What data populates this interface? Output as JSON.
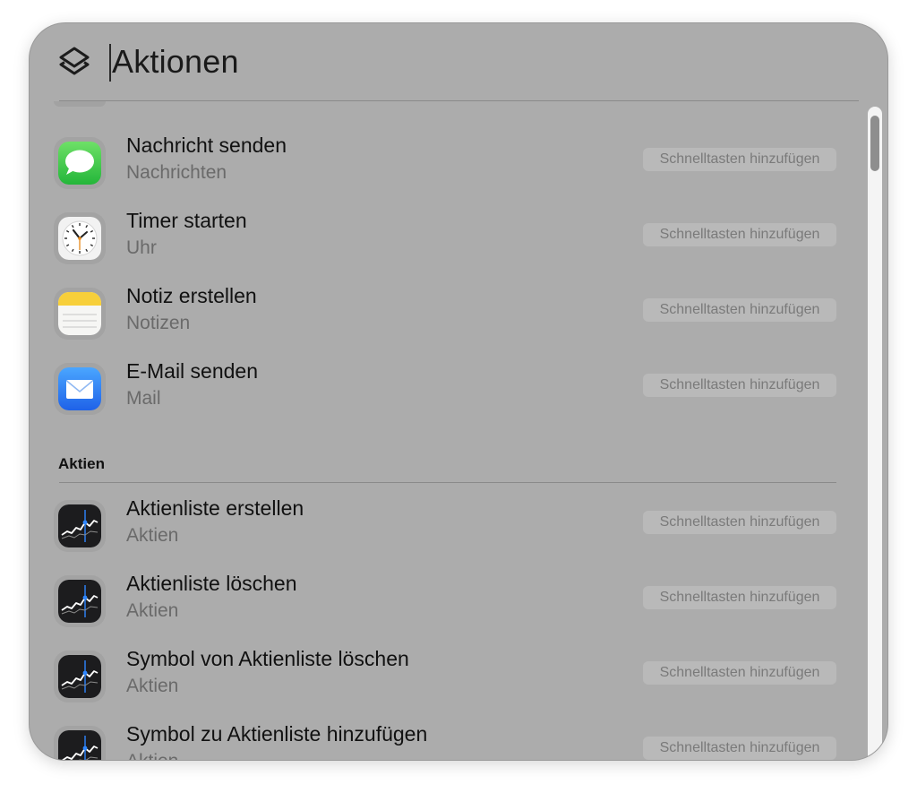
{
  "search": {
    "value": "Aktionen"
  },
  "header": {
    "icon": "shortcuts-icon"
  },
  "groups": [
    {
      "section": "",
      "items": [
        {
          "title": "Nachricht senden",
          "app": "Nachrichten",
          "icon": "messages-icon",
          "shortcut_label": "Schnelltasten hinzufügen"
        },
        {
          "title": "Timer starten",
          "app": "Uhr",
          "icon": "clock-icon",
          "shortcut_label": "Schnelltasten hinzufügen"
        },
        {
          "title": "Notiz erstellen",
          "app": "Notizen",
          "icon": "notes-icon",
          "shortcut_label": "Schnelltasten hinzufügen"
        },
        {
          "title": "E-Mail senden",
          "app": "Mail",
          "icon": "mail-icon",
          "shortcut_label": "Schnelltasten hinzufügen"
        }
      ]
    },
    {
      "section": "Aktien",
      "items": [
        {
          "title": "Aktienliste erstellen",
          "app": "Aktien",
          "icon": "stocks-icon",
          "shortcut_label": "Schnelltasten hinzufügen"
        },
        {
          "title": "Aktienliste löschen",
          "app": "Aktien",
          "icon": "stocks-icon",
          "shortcut_label": "Schnelltasten hinzufügen"
        },
        {
          "title": "Symbol von Aktienliste löschen",
          "app": "Aktien",
          "icon": "stocks-icon",
          "shortcut_label": "Schnelltasten hinzufügen"
        },
        {
          "title": "Symbol zu Aktienliste hinzufügen",
          "app": "Aktien",
          "icon": "stocks-icon",
          "shortcut_label": "Schnelltasten hinzufügen"
        }
      ]
    }
  ],
  "colors": {
    "panel_bg": "#acacac",
    "messages_green": "#3fc94a",
    "mail_blue": "#2f7cf6",
    "notes_yellow": "#f7cf3a",
    "stocks_bg": "#1c1c1e"
  }
}
